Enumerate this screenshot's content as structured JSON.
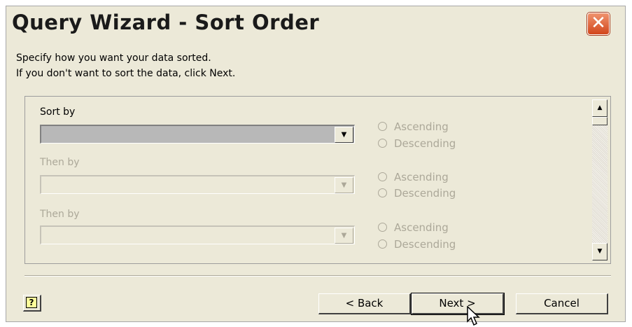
{
  "window": {
    "title": "Query Wizard - Sort Order",
    "close_glyph": "✕"
  },
  "intro": {
    "line1": "Specify how you want your data sorted.",
    "line2": "If you don't want to sort the data, click Next."
  },
  "sort_rows": [
    {
      "label": "Sort by",
      "value": "",
      "enabled": true,
      "option_asc": "Ascending",
      "option_desc": "Descending"
    },
    {
      "label": "Then by",
      "value": "",
      "enabled": false,
      "option_asc": "Ascending",
      "option_desc": "Descending"
    },
    {
      "label": "Then by",
      "value": "",
      "enabled": false,
      "option_asc": "Ascending",
      "option_desc": "Descending"
    }
  ],
  "icons": {
    "combo_arrow": "▼",
    "scroll_up": "▲",
    "scroll_down": "▼",
    "help": "?"
  },
  "buttons": {
    "back": "< Back",
    "next": "Next >",
    "cancel": "Cancel"
  }
}
